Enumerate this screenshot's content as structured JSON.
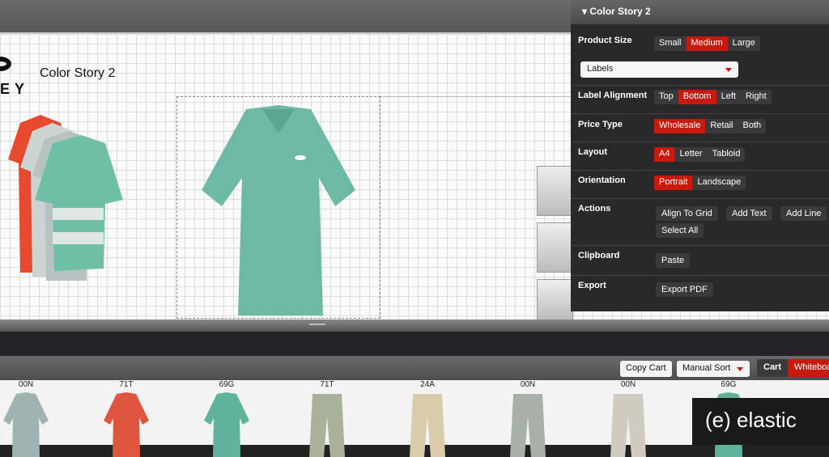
{
  "canvas": {
    "title": "Color Story 2",
    "logo_text": "EY"
  },
  "panel": {
    "title": "Color Story 2",
    "product_size": {
      "label": "Product Size",
      "options": [
        "Small",
        "Medium",
        "Large"
      ],
      "selected": "Medium"
    },
    "labels_select": "Labels",
    "label_alignment": {
      "label": "Label Alignment",
      "options": [
        "Top",
        "Bottom",
        "Left",
        "Right"
      ],
      "selected": "Bottom"
    },
    "price_type": {
      "label": "Price Type",
      "options": [
        "Wholesale",
        "Retail",
        "Both"
      ],
      "selected": "Wholesale"
    },
    "layout": {
      "label": "Layout",
      "options": [
        "A4",
        "Letter",
        "Tabloid"
      ],
      "selected": "A4"
    },
    "orientation": {
      "label": "Orientation",
      "options": [
        "Portrait",
        "Landscape"
      ],
      "selected": "Portrait"
    },
    "actions": {
      "label": "Actions",
      "buttons": [
        "Align To Grid",
        "Add Text",
        "Add Line",
        "Select All"
      ]
    },
    "clipboard": {
      "label": "Clipboard",
      "buttons": [
        "Paste"
      ]
    },
    "export": {
      "label": "Export",
      "buttons": [
        "Export PDF"
      ]
    }
  },
  "toolbar": {
    "copy_cart": "Copy Cart",
    "sort": "Manual Sort",
    "cart": "Cart",
    "whiteboard": "Whiteboard"
  },
  "products": [
    {
      "code": "00N",
      "type": "shirt",
      "color": "#9fb3b0"
    },
    {
      "code": "71T",
      "type": "shirt",
      "color": "#e0553f"
    },
    {
      "code": "69G",
      "type": "shirt",
      "color": "#5fb39a"
    },
    {
      "code": "71T",
      "type": "pants",
      "color": "#a9b19a"
    },
    {
      "code": "24A",
      "type": "pants",
      "color": "#d9ccab"
    },
    {
      "code": "00N",
      "type": "pants",
      "color": "#a8b0aa"
    },
    {
      "code": "00N",
      "type": "pants",
      "color": "#cfcbc0"
    },
    {
      "code": "69G",
      "type": "shirt",
      "color": "#5fb39a"
    }
  ],
  "watermark": "(e) elastic"
}
